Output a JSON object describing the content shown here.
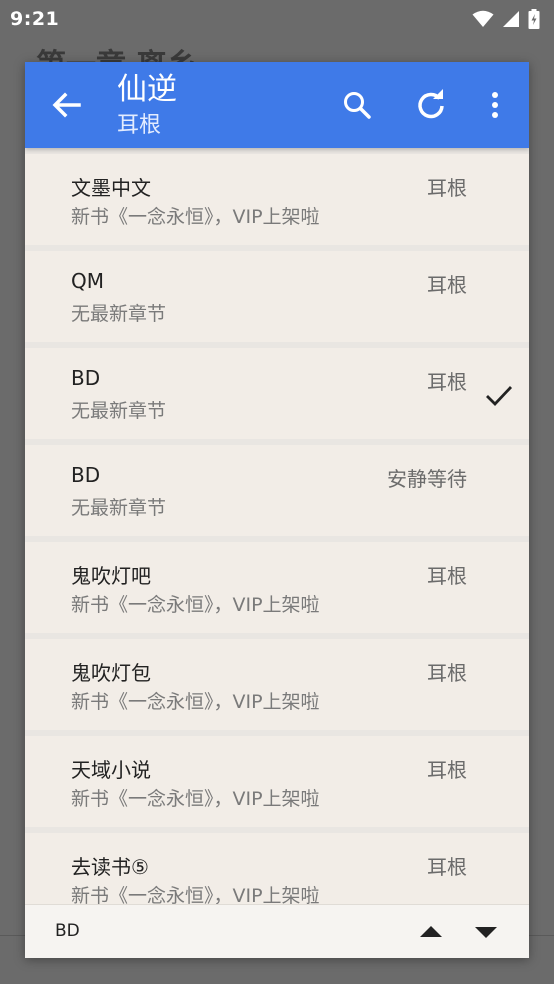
{
  "status_bar": {
    "time": "9:21",
    "icons": [
      "wifi-icon",
      "signal-icon",
      "battery-icon"
    ]
  },
  "background": {
    "title_fragment": "第一章 离乡"
  },
  "dialog": {
    "header": {
      "title": "仙逆",
      "subtitle": "耳根",
      "accent_color": "#3f7ae8",
      "actions": [
        "back-arrow-icon",
        "search-icon",
        "refresh-icon",
        "more-vert-icon"
      ]
    },
    "items": [
      {
        "name": "文墨中文",
        "chapter": "新书《一念永恒》，VIP上架啦",
        "source": "耳根",
        "selected": false
      },
      {
        "name": "QM",
        "chapter": "无最新章节",
        "source": "耳根",
        "selected": false
      },
      {
        "name": "BD",
        "chapter": "无最新章节",
        "source": "耳根",
        "selected": true
      },
      {
        "name": "BD",
        "chapter": "无最新章节",
        "source": "安静等待",
        "selected": false
      },
      {
        "name": "鬼吹灯吧",
        "chapter": "新书《一念永恒》，VIP上架啦",
        "source": "耳根",
        "selected": false
      },
      {
        "name": "鬼吹灯包",
        "chapter": "新书《一念永恒》，VIP上架啦",
        "source": "耳根",
        "selected": false
      },
      {
        "name": "天域小说",
        "chapter": "新书《一念永恒》，VIP上架啦",
        "source": "耳根",
        "selected": false
      },
      {
        "name": "去读书⑤",
        "chapter": "新书《一念永恒》，VIP上架啦",
        "source": "耳根",
        "selected": false
      }
    ],
    "bottom_bar": {
      "label": "BD",
      "actions": [
        "arrow-up-icon",
        "arrow-down-icon"
      ]
    }
  }
}
